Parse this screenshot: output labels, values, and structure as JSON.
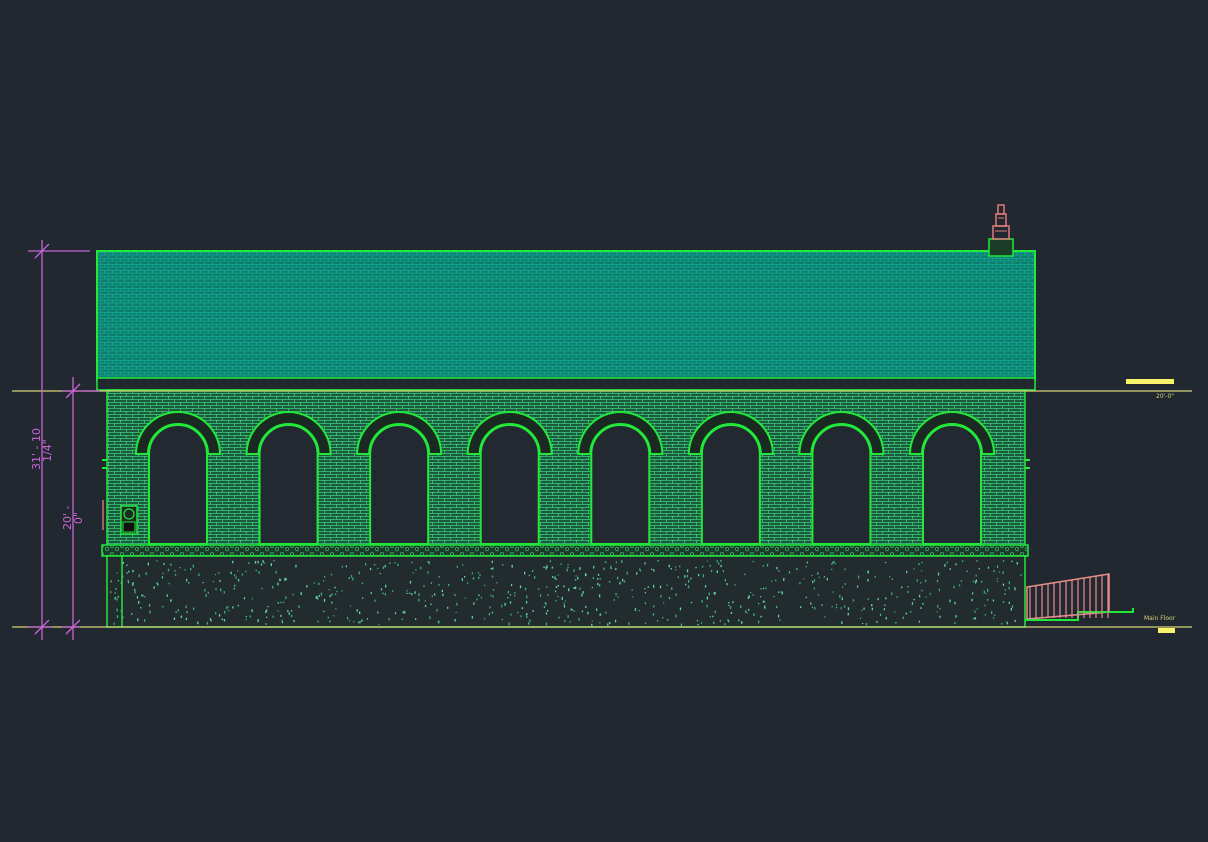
{
  "drawing": {
    "background_color": "#212830",
    "line_color": "#22e83a",
    "roof_fill_color": "#0f7d70",
    "wall_fill_color": "#1c5a3e",
    "dimension_color": "#c964d6",
    "level_line_color": "#d6d27a",
    "marker_color": "#f7f36a",
    "chimney_color": "#e07a7a",
    "ramp_color": "#e78d8d",
    "arch_count": 8
  },
  "dimensions": {
    "overall_height": "31' - 10 1/4\"",
    "overall_height_line1": "31' - 10",
    "overall_height_line2": "1/4\"",
    "wall_height": "20' - 0\"",
    "wall_height_line1": "20' -",
    "wall_height_line2": "0\""
  },
  "levels": {
    "upper_label": "20'-0\"",
    "lower_label": "Main Floor"
  }
}
